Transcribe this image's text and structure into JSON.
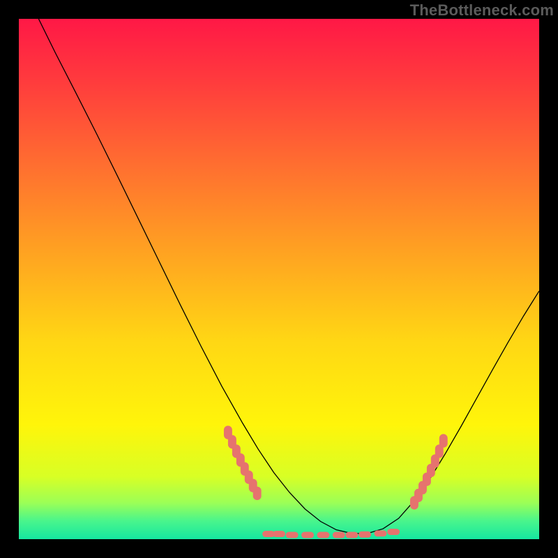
{
  "watermark": "TheBottleneck.com",
  "chart_data": {
    "type": "line",
    "title": "",
    "xlabel": "",
    "ylabel": "",
    "xlim": [
      0,
      100
    ],
    "ylim": [
      0,
      100
    ],
    "grid": false,
    "legend": false,
    "background": {
      "type": "vertical-gradient",
      "stops": [
        {
          "offset": 0.0,
          "color": "#ff1846"
        },
        {
          "offset": 0.12,
          "color": "#ff3b3d"
        },
        {
          "offset": 0.28,
          "color": "#ff6e30"
        },
        {
          "offset": 0.45,
          "color": "#ffa321"
        },
        {
          "offset": 0.62,
          "color": "#ffd714"
        },
        {
          "offset": 0.78,
          "color": "#fff50a"
        },
        {
          "offset": 0.88,
          "color": "#d8ff25"
        },
        {
          "offset": 0.93,
          "color": "#9cff56"
        },
        {
          "offset": 0.965,
          "color": "#49f58c"
        },
        {
          "offset": 1.0,
          "color": "#15e7a0"
        }
      ]
    },
    "series": [
      {
        "name": "curve",
        "color": "#000000",
        "stroke_width": 1.3,
        "x": [
          3.8,
          7,
          11,
          15,
          19,
          23,
          27,
          31,
          35,
          39,
          43,
          46,
          49,
          52,
          55,
          58,
          61,
          64,
          67,
          70,
          73,
          76,
          79,
          82,
          85,
          88,
          91,
          94,
          97,
          100
        ],
        "y": [
          100,
          93.5,
          85.7,
          77.8,
          69.7,
          61.5,
          53.3,
          45.1,
          37.1,
          29.4,
          22.3,
          17.3,
          12.8,
          9.0,
          5.8,
          3.4,
          1.8,
          1.1,
          1.1,
          2.0,
          4.0,
          7.4,
          11.6,
          16.5,
          21.7,
          27.1,
          32.5,
          37.8,
          42.9,
          47.7
        ]
      }
    ],
    "marker_clusters": [
      {
        "name": "floor-dash-left",
        "color": "#e6736e",
        "shape": "rounded-rect",
        "w": 2.4,
        "h": 1.2,
        "points": [
          {
            "x": 48.0,
            "y": 1.0
          },
          {
            "x": 50.0,
            "y": 1.0
          },
          {
            "x": 52.5,
            "y": 0.8
          },
          {
            "x": 55.5,
            "y": 0.8
          },
          {
            "x": 58.5,
            "y": 0.8
          }
        ]
      },
      {
        "name": "floor-dash-right",
        "color": "#e6736e",
        "shape": "rounded-rect",
        "w": 2.4,
        "h": 1.2,
        "points": [
          {
            "x": 61.5,
            "y": 0.8
          },
          {
            "x": 64.0,
            "y": 0.8
          },
          {
            "x": 66.5,
            "y": 0.9
          },
          {
            "x": 69.5,
            "y": 1.1
          },
          {
            "x": 72.0,
            "y": 1.4
          }
        ]
      },
      {
        "name": "left-branch-markers",
        "color": "#e6736e",
        "shape": "rounded-rect",
        "w": 1.6,
        "h": 2.6,
        "points": [
          {
            "x": 40.2,
            "y": 20.5
          },
          {
            "x": 41.0,
            "y": 18.7
          },
          {
            "x": 41.8,
            "y": 16.9
          },
          {
            "x": 42.6,
            "y": 15.2
          },
          {
            "x": 43.4,
            "y": 13.5
          },
          {
            "x": 44.2,
            "y": 11.9
          },
          {
            "x": 45.0,
            "y": 10.3
          },
          {
            "x": 45.8,
            "y": 8.8
          }
        ]
      },
      {
        "name": "right-branch-markers",
        "color": "#e6736e",
        "shape": "rounded-rect",
        "w": 1.6,
        "h": 2.6,
        "points": [
          {
            "x": 76.0,
            "y": 7.0
          },
          {
            "x": 76.8,
            "y": 8.4
          },
          {
            "x": 77.6,
            "y": 9.9
          },
          {
            "x": 78.4,
            "y": 11.5
          },
          {
            "x": 79.2,
            "y": 13.2
          },
          {
            "x": 80.0,
            "y": 15.0
          },
          {
            "x": 80.8,
            "y": 16.9
          },
          {
            "x": 81.6,
            "y": 18.9
          }
        ]
      }
    ]
  }
}
